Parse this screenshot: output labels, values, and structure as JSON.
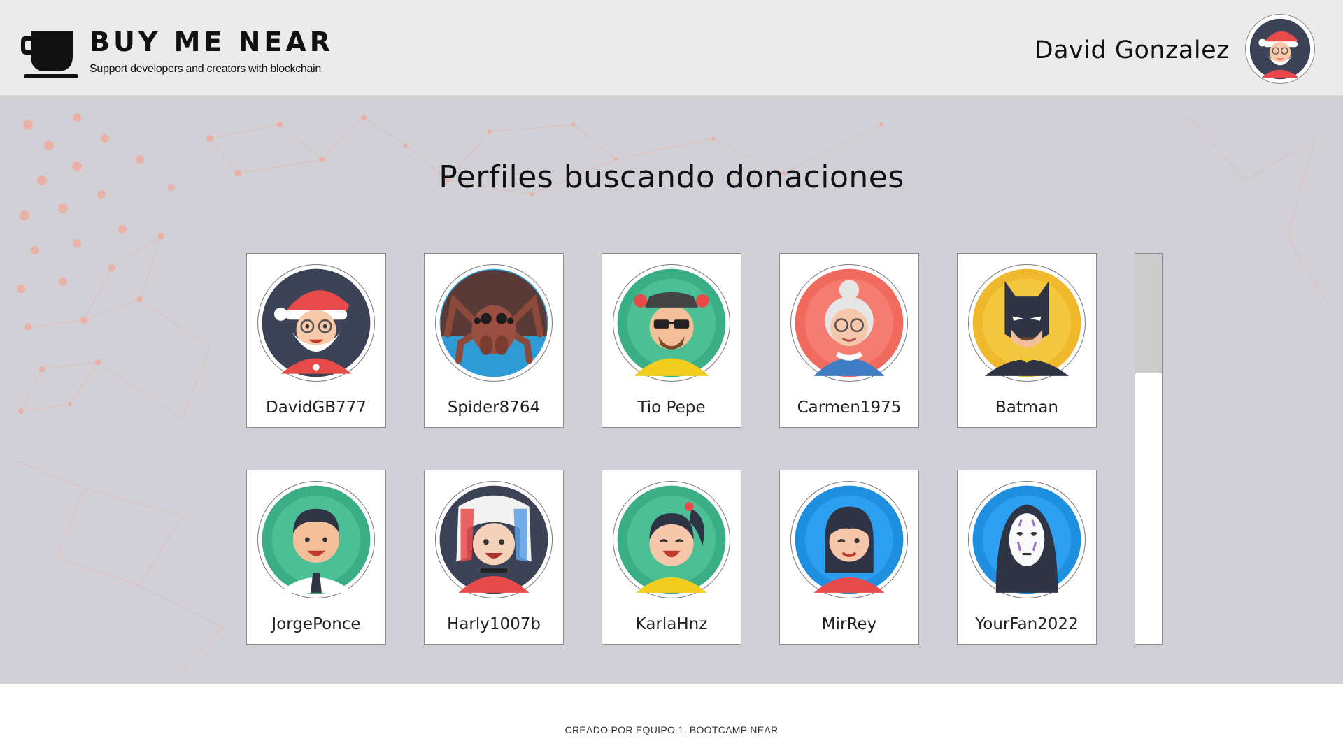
{
  "header": {
    "brand_title": "BUY ME NEAR",
    "brand_tagline": "Support developers and creators with blockchain",
    "logo_icon": "coffee-cup-icon",
    "user_name": "David Gonzalez",
    "user_avatar_icon": "santa-avatar-icon"
  },
  "main": {
    "title": "Perfiles buscando donaciones",
    "profiles": [
      {
        "name": "DavidGB777",
        "avatar": "santa-avatar-icon"
      },
      {
        "name": "Spider8764",
        "avatar": "spider-avatar-icon"
      },
      {
        "name": "Tio Pepe",
        "avatar": "heisenberg-avatar-icon"
      },
      {
        "name": "Carmen1975",
        "avatar": "grandma-avatar-icon"
      },
      {
        "name": "Batman",
        "avatar": "batman-avatar-icon"
      },
      {
        "name": "JorgePonce",
        "avatar": "businessman-avatar-icon"
      },
      {
        "name": "Harly1007b",
        "avatar": "harley-avatar-icon"
      },
      {
        "name": "KarlaHnz",
        "avatar": "girl-ponytail-avatar-icon"
      },
      {
        "name": "MirRey",
        "avatar": "winking-woman-avatar-icon"
      },
      {
        "name": "YourFan2022",
        "avatar": "noface-avatar-icon"
      }
    ]
  },
  "footer": {
    "text": "CREADO POR EQUIPO 1. BOOTCAMP NEAR"
  },
  "colors": {
    "header_bg": "#ebebeb",
    "main_bg": "#d1d0d6",
    "card_bg": "#ffffff",
    "accent_particles": "#f0a090"
  }
}
